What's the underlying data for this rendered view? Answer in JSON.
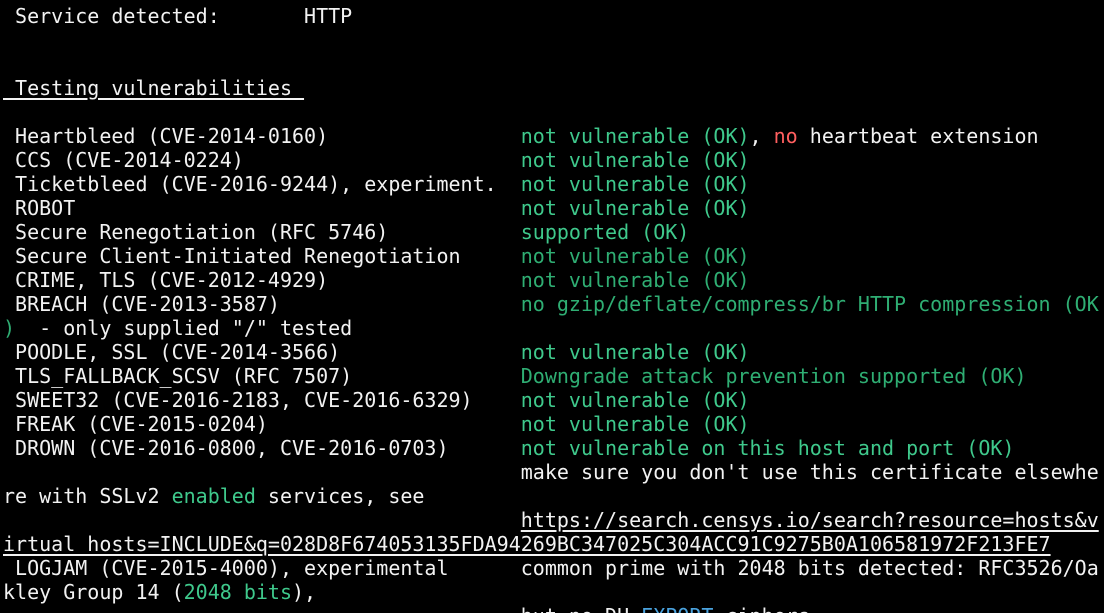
{
  "colors": {
    "background": "#000000",
    "default_text": "#f2f2f2",
    "ok_green": "#3fc98c",
    "dim_green": "#2fae73",
    "warning_red": "#ff5f5f",
    "export_blue": "#4aa3df"
  },
  "lines": [
    {
      "segments": [
        {
          "text": " Service detected:       HTTP",
          "color": "default"
        }
      ]
    },
    {
      "segments": [
        {
          "text": "",
          "color": "default"
        }
      ]
    },
    {
      "segments": [
        {
          "text": "",
          "color": "default"
        }
      ]
    },
    {
      "segments": [
        {
          "text": " Testing vulnerabilities ",
          "color": "default",
          "underline": true
        }
      ]
    },
    {
      "segments": [
        {
          "text": "",
          "color": "default"
        }
      ]
    },
    {
      "segments": [
        {
          "text": " Heartbleed (CVE-2014-0160)                ",
          "color": "default"
        },
        {
          "text": "not vulnerable (OK)",
          "color": "green"
        },
        {
          "text": ", ",
          "color": "default"
        },
        {
          "text": "no",
          "color": "red"
        },
        {
          "text": " heartbeat extension",
          "color": "default"
        }
      ]
    },
    {
      "segments": [
        {
          "text": " CCS (CVE-2014-0224)                       ",
          "color": "default"
        },
        {
          "text": "not vulnerable (OK)",
          "color": "green"
        }
      ]
    },
    {
      "segments": [
        {
          "text": " Ticketbleed (CVE-2016-9244), experiment.  ",
          "color": "default"
        },
        {
          "text": "not vulnerable (OK)",
          "color": "green"
        }
      ]
    },
    {
      "segments": [
        {
          "text": " ROBOT                                     ",
          "color": "default"
        },
        {
          "text": "not vulnerable (OK)",
          "color": "green"
        }
      ]
    },
    {
      "segments": [
        {
          "text": " Secure Renegotiation (RFC 5746)           ",
          "color": "default"
        },
        {
          "text": "supported (OK)",
          "color": "green"
        }
      ]
    },
    {
      "segments": [
        {
          "text": " Secure Client-Initiated Renegotiation     ",
          "color": "default"
        },
        {
          "text": "not vulnerable (OK)",
          "color": "dim-green"
        }
      ]
    },
    {
      "segments": [
        {
          "text": " CRIME, TLS (CVE-2012-4929)                ",
          "color": "default"
        },
        {
          "text": "not vulnerable (OK)",
          "color": "dim-green"
        }
      ]
    },
    {
      "segments": [
        {
          "text": " BREACH (CVE-2013-3587)                    ",
          "color": "default"
        },
        {
          "text": "no gzip/deflate/compress/br HTTP compression (OK",
          "color": "dim-green"
        }
      ]
    },
    {
      "segments": [
        {
          "text": ")",
          "color": "dim-green"
        },
        {
          "text": "  - only supplied \"/\" tested",
          "color": "default"
        }
      ]
    },
    {
      "segments": [
        {
          "text": " POODLE, SSL (CVE-2014-3566)               ",
          "color": "default"
        },
        {
          "text": "not vulnerable (OK)",
          "color": "green"
        }
      ]
    },
    {
      "segments": [
        {
          "text": " TLS_FALLBACK_SCSV (RFC 7507)              ",
          "color": "default"
        },
        {
          "text": "Downgrade attack prevention supported (OK)",
          "color": "dim-green"
        }
      ]
    },
    {
      "segments": [
        {
          "text": " SWEET32 (CVE-2016-2183, CVE-2016-6329)    ",
          "color": "default"
        },
        {
          "text": "not vulnerable (OK)",
          "color": "green"
        }
      ]
    },
    {
      "segments": [
        {
          "text": " FREAK (CVE-2015-0204)                     ",
          "color": "default"
        },
        {
          "text": "not vulnerable (OK)",
          "color": "green"
        }
      ]
    },
    {
      "segments": [
        {
          "text": " DROWN (CVE-2016-0800, CVE-2016-0703)      ",
          "color": "default"
        },
        {
          "text": "not vulnerable on this host and port (OK)",
          "color": "green"
        }
      ]
    },
    {
      "segments": [
        {
          "text": "                                           make sure you don't use this certificate elsewhe",
          "color": "default"
        }
      ]
    },
    {
      "segments": [
        {
          "text": "re with SSLv2 ",
          "color": "default"
        },
        {
          "text": "enabled",
          "color": "green"
        },
        {
          "text": " services, see",
          "color": "default"
        }
      ]
    },
    {
      "segments": [
        {
          "text": "                                           ",
          "color": "default"
        },
        {
          "text": "https://search.censys.io/search?resource=hosts&v",
          "color": "default",
          "underline": true
        }
      ]
    },
    {
      "segments": [
        {
          "text": "irtual_hosts=INCLUDE&q=028D8F674053135FDA94269BC347025C304ACC91C9275B0A106581972F213FE7",
          "color": "default",
          "underline": true
        }
      ]
    },
    {
      "segments": [
        {
          "text": " LOGJAM (CVE-2015-4000), experimental      ",
          "color": "default"
        },
        {
          "text": "common prime with 2048 bits detected: RFC3526/Oa",
          "color": "default"
        }
      ]
    },
    {
      "segments": [
        {
          "text": "kley Group 14 (",
          "color": "default"
        },
        {
          "text": "2048 bits",
          "color": "green"
        },
        {
          "text": "),",
          "color": "default"
        }
      ]
    },
    {
      "segments": [
        {
          "text": "                                           but no DH ",
          "color": "default"
        },
        {
          "text": "EXPORT",
          "color": "blue"
        },
        {
          "text": " ciphers",
          "color": "default"
        }
      ]
    }
  ]
}
